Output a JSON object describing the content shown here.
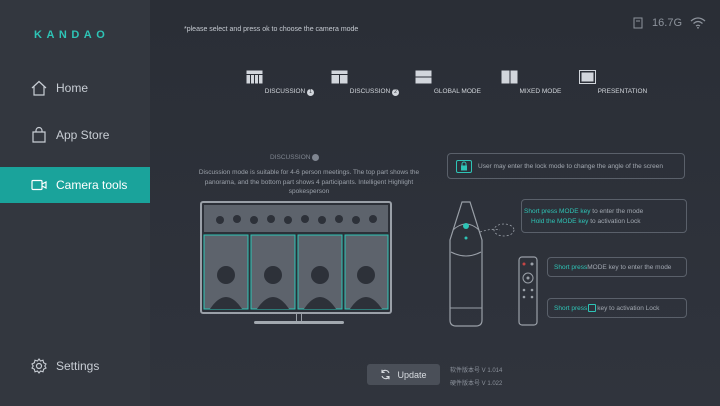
{
  "sidebar": {
    "logo": "KANDAO",
    "items": [
      {
        "label": "Home"
      },
      {
        "label": "App Store"
      },
      {
        "label": "Camera tools"
      },
      {
        "label": "Settings"
      }
    ]
  },
  "header": {
    "hint": "*please select and press ok to choose the camera mode",
    "storage": "16.7G"
  },
  "modes": [
    {
      "label": "DISCUSSION",
      "badge": "1"
    },
    {
      "label": "DISCUSSION",
      "badge": "2"
    },
    {
      "label": "GLOBAL MODE"
    },
    {
      "label": "MIXED MODE"
    },
    {
      "label": "PRESENTATION"
    }
  ],
  "description": {
    "title": "DISCUSSION",
    "text": "Discussion mode is suitable for 4-6 person meetings. The top part shows the panorama, and the bottom part shows 4 participants. Intelligent Highlight spokesperson"
  },
  "tips": {
    "lock": "User may enter the lock mode to change the angle of the screen",
    "camera_short": "Short press MODE key",
    "camera_short_rest": " to enter the mode",
    "camera_hold": "Hold the MODE key",
    "camera_hold_rest": " to activation Lock",
    "remote_short": "Short press",
    "remote_short_rest": " MODE key to enter the mode",
    "remote_lock": "Short press",
    "remote_lock_rest": " key to activation Lock"
  },
  "footer": {
    "update_label": "Update",
    "software_version": "软件版本号  V 1.014",
    "hardware_version": "硬件版本号  V 1.022"
  },
  "colors": {
    "accent": "#1aa39b",
    "teal_text": "#2ec4b6",
    "background": "#2b2f37"
  }
}
